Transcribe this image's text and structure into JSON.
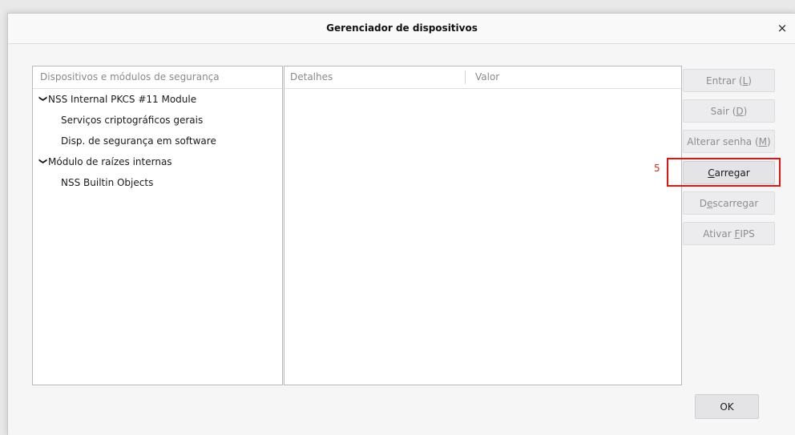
{
  "dialog": {
    "title": "Gerenciador de dispositivos",
    "close_glyph": "×"
  },
  "left_pane": {
    "header": "Dispositivos e módulos de segurança",
    "tree": [
      {
        "label": "NSS Internal PKCS #11 Module",
        "level": 0,
        "expanded": true
      },
      {
        "label": "Serviços criptográficos gerais",
        "level": 1
      },
      {
        "label": "Disp. de segurança em software",
        "level": 1
      },
      {
        "label": "Módulo de raízes internas",
        "level": 0,
        "expanded": true
      },
      {
        "label": "NSS Builtin Objects",
        "level": 1
      }
    ]
  },
  "right_pane": {
    "headers": [
      "Detalhes",
      "Valor"
    ]
  },
  "buttons": [
    {
      "pre": "Entrar (",
      "key": "L",
      "post": ")",
      "enabled": false
    },
    {
      "pre": "Sair (",
      "key": "D",
      "post": ")",
      "enabled": false
    },
    {
      "pre": "Alterar senha (",
      "key": "M",
      "post": ")",
      "enabled": false
    },
    {
      "pre": "",
      "key": "C",
      "post": "arregar",
      "enabled": true
    },
    {
      "pre": "D",
      "key": "e",
      "post": "scarregar",
      "enabled": false
    },
    {
      "pre": "Ativar ",
      "key": "F",
      "post": "IPS",
      "enabled": false
    }
  ],
  "annotation": {
    "step": "5",
    "color": "#e3130f"
  },
  "ok_label": "OK"
}
